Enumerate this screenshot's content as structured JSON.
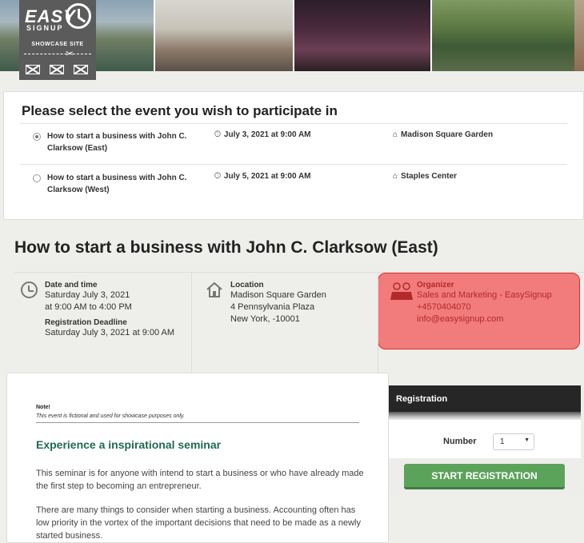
{
  "logo": {
    "easy": "EASY",
    "signup": "SIGNUP",
    "showcase": "SHOWCASE SITE"
  },
  "selector": {
    "title": "Please select the event you wish to participate in",
    "events": [
      {
        "name": "How to start a business with John C. Clarksow (East)",
        "date": "July 3, 2021 at 9:00 AM",
        "venue": "Madison Square Garden",
        "selected": true
      },
      {
        "name": "How to start a business with John C. Clarksow (West)",
        "date": "July 5, 2021 at 9:00 AM",
        "venue": "Staples Center",
        "selected": false
      }
    ]
  },
  "event": {
    "title": "How to start a business with John C. Clarksow (East)",
    "datetime_label": "Date and time",
    "date": "Saturday July 3, 2021",
    "time": "at 9:00 AM to 4:00 PM",
    "deadline_label": "Registration Deadline",
    "deadline": "Saturday July 3, 2021 at 9:00 AM",
    "location_label": "Location",
    "venue": "Madison Square Garden",
    "address": "4 Pennsylvania Plaza",
    "city": "New York, -10001",
    "organizer_label": "Organizer",
    "organizer": "Sales and Marketing - EasySignup",
    "phone": "+4570404070",
    "email": "info@easysignup.com"
  },
  "note": {
    "head": "Note!",
    "sub": "This event is fictional and used for showcase purposes only.",
    "title": "Experience a inspirational seminar",
    "para1": "This seminar is for anyone with intend to start a business or who have already made the first step to becoming an entrepreneur.",
    "para2": "There are many things to consider when starting a business. Accounting often has low priority in the vortex of the important decisions that need to be made as a newly started business."
  },
  "registration": {
    "title": "Registration",
    "number_label": "Number",
    "number_value": "1",
    "button": "START REGISTRATION"
  },
  "colors": {
    "highlight": "#f27b7b",
    "highlight_border": "#e02e2e",
    "button": "#5ba35a",
    "heading_green": "#1f6b4d"
  },
  "icons": [
    "clock-icon",
    "house-icon",
    "people-icon",
    "scissors-icon",
    "envelope-icon",
    "chevron-down-icon"
  ]
}
